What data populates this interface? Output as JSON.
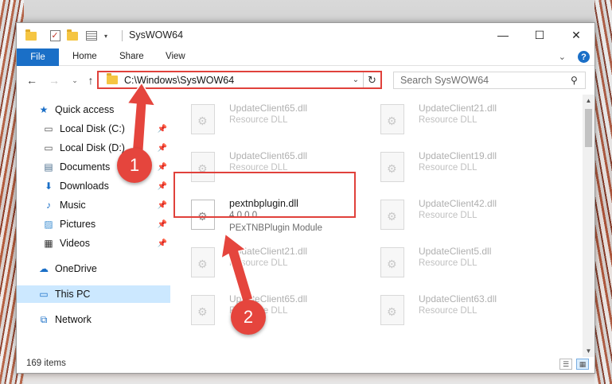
{
  "window": {
    "title": "SysWOW64",
    "controls": {
      "minimize": "—",
      "maximize": "☐",
      "close": "✕"
    }
  },
  "ribbon": {
    "tabs": [
      "File",
      "Home",
      "Share",
      "View"
    ],
    "expand_icon": "chevron-down-icon",
    "help_label": "?"
  },
  "navigation": {
    "address": "C:\\Windows\\SysWOW64",
    "search_placeholder": "Search SysWOW64"
  },
  "sidebar": {
    "items": [
      {
        "label": "Quick access",
        "icon": "star-icon",
        "pinned": false
      },
      {
        "label": "Local Disk (C:)",
        "icon": "drive-icon",
        "pinned": true
      },
      {
        "label": "Local Disk (D:)",
        "icon": "drive-icon",
        "pinned": true
      },
      {
        "label": "Documents",
        "icon": "documents-icon",
        "pinned": true
      },
      {
        "label": "Downloads",
        "icon": "download-icon",
        "pinned": true
      },
      {
        "label": "Music",
        "icon": "music-icon",
        "pinned": true
      },
      {
        "label": "Pictures",
        "icon": "pictures-icon",
        "pinned": true
      },
      {
        "label": "Videos",
        "icon": "videos-icon",
        "pinned": true
      },
      {
        "label": "OneDrive",
        "icon": "cloud-icon",
        "pinned": false
      },
      {
        "label": "This PC",
        "icon": "computer-icon",
        "pinned": false,
        "selected": true
      },
      {
        "label": "Network",
        "icon": "network-icon",
        "pinned": false
      }
    ]
  },
  "files": [
    {
      "name": "UpdateClient65.dll",
      "desc": "Resource DLL"
    },
    {
      "name": "UpdateClient21.dll",
      "desc": "Resource DLL"
    },
    {
      "name": "UpdateClient65.dll",
      "desc": "Resource DLL"
    },
    {
      "name": "UpdateClient19.dll",
      "desc": "Resource DLL"
    },
    {
      "name": "pextnbplugin.dll",
      "version": "4.0.0.0",
      "desc": "PExTNBPlugin Module",
      "highlighted": true
    },
    {
      "name": "UpdateClient42.dll",
      "desc": "Resource DLL"
    },
    {
      "name": "UpdateClient21.dll",
      "desc": "Resource DLL"
    },
    {
      "name": "UpdateClient5.dll",
      "desc": "Resource DLL"
    },
    {
      "name": "UpdateClient65.dll",
      "desc": "Resource DLL"
    },
    {
      "name": "UpdateClient63.dll",
      "desc": "Resource DLL"
    }
  ],
  "status": {
    "item_count": "169 items"
  },
  "annotations": {
    "step1": "1",
    "step2": "2",
    "accent": "#e5453d"
  }
}
